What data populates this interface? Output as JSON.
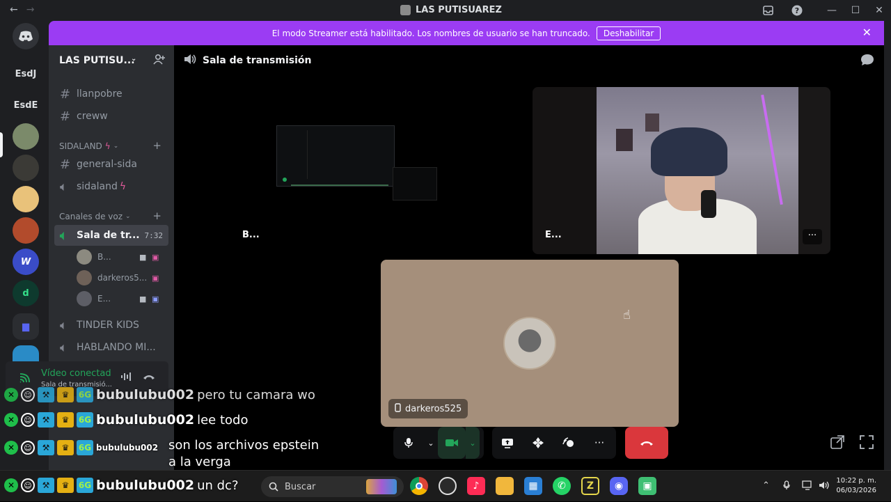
{
  "window": {
    "title": "LAS PUTISUAREZ",
    "nav_back": "←",
    "nav_forward": "→",
    "inbox_icon": "inbox-icon",
    "help_icon": "help-icon",
    "minimize": "—",
    "maximize": "☐",
    "close": "✕"
  },
  "banner": {
    "text": "El modo Streamer está habilitado. Los nombres de usuario se han truncado.",
    "button": "Deshabilitar",
    "close": "✕",
    "color": "#9b3cf3"
  },
  "servers": [
    {
      "label": "EsdJ"
    },
    {
      "label": "EsdE"
    }
  ],
  "guild": {
    "name": "LAS PUTISU...",
    "chevron": "⌄",
    "invite_icon": "add-member-icon"
  },
  "channels": {
    "top": [
      {
        "name": "llanpobre"
      },
      {
        "name": "creww"
      }
    ],
    "sidaland_category": "SIDALAND",
    "sidaland": [
      {
        "name": "general-sida"
      },
      {
        "name": "sidaland"
      }
    ],
    "voice_category": "Canales de voz",
    "active_voice": {
      "name": "Sala de tr...",
      "timer": "7:32"
    },
    "voice_users": [
      {
        "name": "B..."
      },
      {
        "name": "darkeros5..."
      },
      {
        "name": "E..."
      }
    ],
    "other_voice": [
      {
        "name": "TINDER KIDS"
      },
      {
        "name": "HABLANDO MI..."
      }
    ]
  },
  "voice_panel": {
    "status": "Vídeo conectad",
    "channel": "Sala de transmisió..."
  },
  "stage": {
    "channel_name": "Sala de transmisión",
    "tiles": [
      {
        "name": "B..."
      },
      {
        "name": "E...",
        "more": "···"
      },
      {
        "name": "darkeros525"
      }
    ]
  },
  "controls": {
    "more": "···",
    "hangup_icon": "phone-hangup-icon"
  },
  "overlay": {
    "lines": [
      {
        "user": "bubulubu002",
        "message": "pero tu camara wo"
      },
      {
        "user": "bubulubu002",
        "message": "lee todo"
      },
      {
        "user": "bubulubu002",
        "message": "son los archivos epstein",
        "message2": "a la verga"
      },
      {
        "user": "bubulubu002",
        "message": "un dc?"
      }
    ],
    "badge_text": "6G"
  },
  "taskbar": {
    "search_placeholder": "Buscar",
    "time": "10:22 p. m.",
    "date": "06/03/2026"
  }
}
